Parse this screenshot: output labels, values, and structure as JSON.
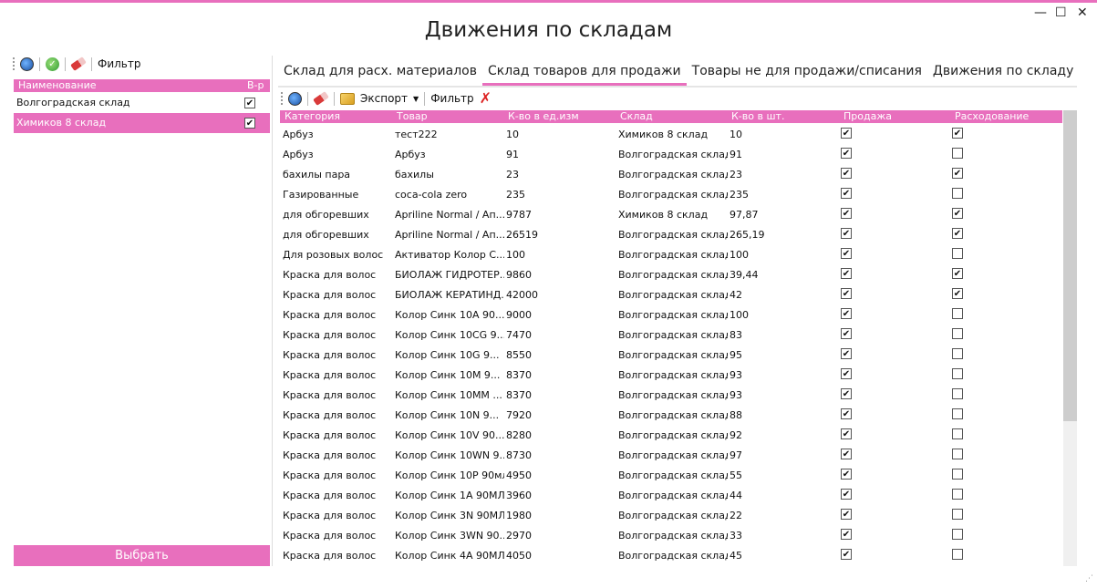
{
  "window": {
    "title": "Движения по складам",
    "min_glyph": "—",
    "max_glyph": "☐",
    "close_glyph": "✕"
  },
  "left_toolbar": {
    "filter_label": "Фильтр"
  },
  "warehouse_list": {
    "columns": {
      "name": "Наименование",
      "flag": "В-р"
    },
    "rows": [
      {
        "name": "Волгоградская склад",
        "checked": true,
        "selected": false
      },
      {
        "name": "Химиков 8 склад",
        "checked": true,
        "selected": true
      }
    ],
    "select_button": "Выбрать"
  },
  "tabs": [
    {
      "label": "Склад для расх. материалов",
      "active": false
    },
    {
      "label": "Склад товаров для продажи",
      "active": true
    },
    {
      "label": "Товары не для продажи/списания",
      "active": false
    },
    {
      "label": "Движения по складу",
      "active": false
    }
  ],
  "grid_toolbar": {
    "export_label": "Экспорт",
    "filter_label": "Фильтр"
  },
  "grid": {
    "columns": {
      "category": "Категория",
      "product": "Товар",
      "qty_unit": "К-во в ед.изм",
      "warehouse": "Склад",
      "qty_pcs": "К-во в шт.",
      "sale": "Продажа",
      "consumption": "Расходование"
    },
    "rows": [
      {
        "category": "Арбуз",
        "product": "тест222",
        "qty_unit": "10",
        "warehouse": "Химиков 8 склад",
        "qty_pcs": "10",
        "sale": true,
        "consumption": true
      },
      {
        "category": "Арбуз",
        "product": "Арбуз",
        "qty_unit": "91",
        "warehouse": "Волгоградская склад",
        "qty_pcs": "91",
        "sale": true,
        "consumption": false
      },
      {
        "category": "бахилы пара",
        "product": "бахилы",
        "qty_unit": "23",
        "warehouse": "Волгоградская склад",
        "qty_pcs": "23",
        "sale": true,
        "consumption": true
      },
      {
        "category": "Газированные",
        "product": "coca-cola zero",
        "qty_unit": "235",
        "warehouse": "Волгоградская склад",
        "qty_pcs": "235",
        "sale": true,
        "consumption": false
      },
      {
        "category": "для обгоревших",
        "product": "Apriline Normal / Ап...",
        "qty_unit": "9787",
        "warehouse": "Химиков 8 склад",
        "qty_pcs": "97,87",
        "sale": true,
        "consumption": true
      },
      {
        "category": "для обгоревших",
        "product": "Apriline Normal / Ап...",
        "qty_unit": "26519",
        "warehouse": "Волгоградская склад",
        "qty_pcs": "265,19",
        "sale": true,
        "consumption": true
      },
      {
        "category": "Для розовых волос",
        "product": "Активатор Колор С...",
        "qty_unit": "100",
        "warehouse": "Волгоградская склад",
        "qty_pcs": "100",
        "sale": true,
        "consumption": false
      },
      {
        "category": "Краска для волос",
        "product": "БИОЛАЖ ГИДРОТЕР...",
        "qty_unit": "9860",
        "warehouse": "Волгоградская склад",
        "qty_pcs": "39,44",
        "sale": true,
        "consumption": true
      },
      {
        "category": "Краска для волос",
        "product": "БИОЛАЖ КЕРАТИНД...",
        "qty_unit": "42000",
        "warehouse": "Волгоградская склад",
        "qty_pcs": "42",
        "sale": true,
        "consumption": true
      },
      {
        "category": "Краска для волос",
        "product": "Колор Синк 10А 90...",
        "qty_unit": "9000",
        "warehouse": "Волгоградская склад",
        "qty_pcs": "100",
        "sale": true,
        "consumption": false
      },
      {
        "category": "Краска для волос",
        "product": "Колор Синк 10CG 9...",
        "qty_unit": "7470",
        "warehouse": "Волгоградская склад",
        "qty_pcs": "83",
        "sale": true,
        "consumption": false
      },
      {
        "category": "Краска для волос",
        "product": "Колор Синк 10G 9...",
        "qty_unit": "8550",
        "warehouse": "Волгоградская склад",
        "qty_pcs": "95",
        "sale": true,
        "consumption": false
      },
      {
        "category": "Краска для волос",
        "product": "Колор Синк 10M 9...",
        "qty_unit": "8370",
        "warehouse": "Волгоградская склад",
        "qty_pcs": "93",
        "sale": true,
        "consumption": false
      },
      {
        "category": "Краска для волос",
        "product": "Колор Синк 10MM ...",
        "qty_unit": "8370",
        "warehouse": "Волгоградская склад",
        "qty_pcs": "93",
        "sale": true,
        "consumption": false
      },
      {
        "category": "Краска для волос",
        "product": "Колор Синк 10N 9...",
        "qty_unit": "7920",
        "warehouse": "Волгоградская склад",
        "qty_pcs": "88",
        "sale": true,
        "consumption": false
      },
      {
        "category": "Краска для волос",
        "product": "Колор Синк 10V 90...",
        "qty_unit": "8280",
        "warehouse": "Волгоградская склад",
        "qty_pcs": "92",
        "sale": true,
        "consumption": false
      },
      {
        "category": "Краска для волос",
        "product": "Колор Синк 10WN 9...",
        "qty_unit": "8730",
        "warehouse": "Волгоградская склад",
        "qty_pcs": "97",
        "sale": true,
        "consumption": false
      },
      {
        "category": "Краска для волос",
        "product": "Колор Синк 10P 90мл",
        "qty_unit": "4950",
        "warehouse": "Волгоградская склад",
        "qty_pcs": "55",
        "sale": true,
        "consumption": false
      },
      {
        "category": "Краска для волос",
        "product": "Колор Синк 1А 90МЛ",
        "qty_unit": "3960",
        "warehouse": "Волгоградская склад",
        "qty_pcs": "44",
        "sale": true,
        "consumption": false
      },
      {
        "category": "Краска для волос",
        "product": "Колор Синк 3N 90МЛ",
        "qty_unit": "1980",
        "warehouse": "Волгоградская склад",
        "qty_pcs": "22",
        "sale": true,
        "consumption": false
      },
      {
        "category": "Краска для волос",
        "product": "Колор Синк 3WN 90...",
        "qty_unit": "2970",
        "warehouse": "Волгоградская склад",
        "qty_pcs": "33",
        "sale": true,
        "consumption": false
      },
      {
        "category": "Краска для волос",
        "product": "Колор Синк 4А 90МЛ",
        "qty_unit": "4050",
        "warehouse": "Волгоградская склад",
        "qty_pcs": "45",
        "sale": true,
        "consumption": false
      }
    ]
  },
  "colors": {
    "accent": "#e86fbd"
  }
}
